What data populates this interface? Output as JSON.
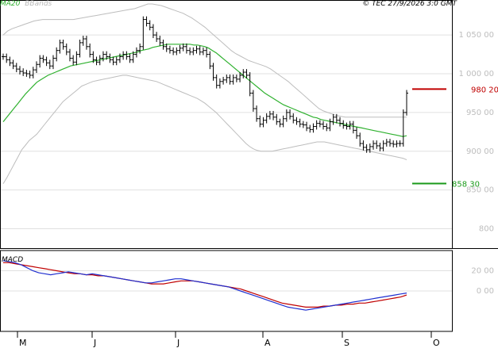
{
  "header": {
    "ma_label": "MA20",
    "bb_label": "BBands",
    "copyright": "© TEC 27/9/2026 3:0 GMT"
  },
  "macd_label": "MACD",
  "colors": {
    "price": "#000000",
    "ma20": "#2fb12f",
    "bbands": "#bdbdbd",
    "resistance": "#c00000",
    "support": "#1a9a1a",
    "macd_line": "#1f2fd0",
    "signal_line": "#c00000",
    "grid": "#e0e0e0"
  },
  "chart_data": [
    {
      "type": "ohlc",
      "title": "",
      "x_months": [
        "M",
        "J",
        "J",
        "A",
        "S",
        "O"
      ],
      "y_ticks": [
        800,
        850,
        900,
        950,
        1000,
        1050
      ],
      "y_tick_labels": [
        "800",
        "850 00",
        "900 00",
        "950 00",
        "1 000 00",
        "1 050 00"
      ],
      "ylim": [
        775,
        1090
      ],
      "sessions": 110,
      "close": [
        1022,
        1018,
        1014,
        1010,
        1006,
        1003,
        1001,
        1000,
        998,
        1005,
        1012,
        1020,
        1018,
        1014,
        1010,
        1020,
        1030,
        1040,
        1035,
        1028,
        1020,
        1015,
        1025,
        1040,
        1045,
        1035,
        1025,
        1018,
        1015,
        1020,
        1025,
        1022,
        1018,
        1015,
        1018,
        1022,
        1025,
        1022,
        1018,
        1025,
        1030,
        1035,
        1070,
        1065,
        1060,
        1050,
        1045,
        1040,
        1035,
        1032,
        1030,
        1028,
        1030,
        1033,
        1035,
        1030,
        1028,
        1030,
        1032,
        1028,
        1030,
        1025,
        1010,
        995,
        985,
        990,
        992,
        995,
        990,
        995,
        993,
        998,
        1002,
        998,
        975,
        955,
        942,
        935,
        940,
        945,
        948,
        944,
        938,
        935,
        942,
        950,
        945,
        940,
        938,
        935,
        934,
        930,
        928,
        932,
        936,
        935,
        932,
        930,
        938,
        944,
        940,
        936,
        933,
        932,
        935,
        927,
        920,
        910,
        905,
        902,
        906,
        910,
        907,
        904,
        910,
        912,
        910,
        909,
        910,
        910,
        950,
        975
      ],
      "ma20": [
        938,
        944,
        950,
        956,
        962,
        968,
        974,
        979,
        984,
        989,
        992,
        995,
        998,
        1000,
        1002,
        1004,
        1006,
        1008,
        1010,
        1011,
        1012,
        1013,
        1014,
        1015,
        1016,
        1017,
        1018,
        1019,
        1020,
        1021,
        1022,
        1023,
        1024,
        1025,
        1026,
        1027,
        1028,
        1030,
        1031,
        1032,
        1034,
        1035,
        1036,
        1037,
        1038,
        1038,
        1038,
        1038,
        1038,
        1038,
        1038,
        1037,
        1037,
        1036,
        1035,
        1033,
        1030,
        1027,
        1023,
        1019,
        1015,
        1011,
        1007,
        1003,
        999,
        995,
        991,
        987,
        983,
        979,
        975,
        972,
        969,
        966,
        963,
        960,
        958,
        956,
        954,
        952,
        950,
        948,
        946,
        944,
        943,
        941,
        940,
        939,
        938,
        937,
        936,
        935,
        934,
        933,
        932,
        931,
        930,
        929,
        928,
        927,
        926,
        925,
        924,
        923,
        922,
        921,
        920,
        919,
        920
      ],
      "bb_upper": [
        1050,
        1055,
        1058,
        1060,
        1062,
        1064,
        1066,
        1068,
        1069,
        1070,
        1070,
        1070,
        1070,
        1070,
        1070,
        1070,
        1070,
        1071,
        1072,
        1073,
        1074,
        1075,
        1076,
        1077,
        1078,
        1079,
        1080,
        1081,
        1082,
        1083,
        1084,
        1086,
        1088,
        1090,
        1090,
        1089,
        1088,
        1086,
        1084,
        1082,
        1080,
        1078,
        1075,
        1072,
        1068,
        1064,
        1060,
        1055,
        1050,
        1045,
        1040,
        1035,
        1030,
        1026,
        1023,
        1020,
        1017,
        1015,
        1013,
        1011,
        1009,
        1006,
        1002,
        998,
        994,
        990,
        985,
        980,
        975,
        970,
        965,
        960,
        955,
        952,
        950,
        948,
        946,
        945,
        944,
        944,
        944,
        944,
        944,
        944,
        944,
        944,
        944,
        944,
        944,
        944,
        944,
        944,
        944
      ],
      "bb_lower": [
        858,
        866,
        875,
        884,
        893,
        902,
        908,
        914,
        918,
        922,
        928,
        934,
        940,
        946,
        952,
        958,
        964,
        968,
        972,
        976,
        980,
        984,
        986,
        988,
        990,
        991,
        992,
        993,
        994,
        995,
        996,
        997,
        998,
        998,
        997,
        996,
        995,
        994,
        993,
        992,
        991,
        990,
        988,
        986,
        984,
        982,
        980,
        978,
        976,
        974,
        972,
        970,
        968,
        965,
        962,
        958,
        954,
        950,
        945,
        940,
        935,
        930,
        925,
        920,
        915,
        910,
        906,
        903,
        901,
        900,
        900,
        900,
        900,
        901,
        902,
        903,
        904,
        905,
        906,
        907,
        908,
        909,
        910,
        911,
        912,
        912,
        912,
        911,
        910,
        909,
        908,
        907,
        906,
        905,
        904,
        903,
        902,
        901,
        900,
        899,
        898,
        897,
        896,
        895,
        894,
        893,
        892,
        891,
        889
      ],
      "resistance": {
        "value": 980.2,
        "label": "980 20"
      },
      "support": {
        "value": 858.3,
        "label": "858 30"
      }
    },
    {
      "type": "line",
      "title": "MACD",
      "y_ticks": [
        0,
        20
      ],
      "y_tick_labels": [
        "0 00",
        "20 00"
      ],
      "ylim": [
        -40,
        40
      ],
      "series": [
        {
          "name": "MACD",
          "values": [
            30,
            29,
            28,
            26,
            23,
            20,
            18,
            17,
            16,
            17,
            18,
            19,
            18,
            17,
            16,
            17,
            16,
            15,
            14,
            13,
            12,
            11,
            10,
            9,
            8,
            8,
            9,
            10,
            11,
            12,
            12,
            11,
            10,
            9,
            8,
            7,
            6,
            5,
            4,
            2,
            0,
            -2,
            -4,
            -6,
            -8,
            -10,
            -12,
            -14,
            -16,
            -17,
            -18,
            -19,
            -18,
            -17,
            -16,
            -15,
            -14,
            -13,
            -12,
            -11,
            -10,
            -9,
            -8,
            -7,
            -6,
            -5,
            -4,
            -3,
            -2
          ]
        },
        {
          "name": "Signal",
          "values": [
            28,
            28,
            27,
            26,
            25,
            24,
            23,
            22,
            21,
            20,
            19,
            18,
            17,
            17,
            16,
            16,
            15,
            15,
            14,
            13,
            12,
            11,
            10,
            9,
            8,
            7,
            7,
            7,
            8,
            9,
            10,
            10,
            10,
            9,
            8,
            7,
            6,
            5,
            4,
            3,
            2,
            0,
            -2,
            -4,
            -6,
            -8,
            -10,
            -12,
            -13,
            -14,
            -15,
            -16,
            -16,
            -16,
            -15,
            -15,
            -14,
            -14,
            -13,
            -13,
            -12,
            -12,
            -11,
            -10,
            -9,
            -8,
            -7,
            -6,
            -4
          ]
        }
      ]
    }
  ]
}
